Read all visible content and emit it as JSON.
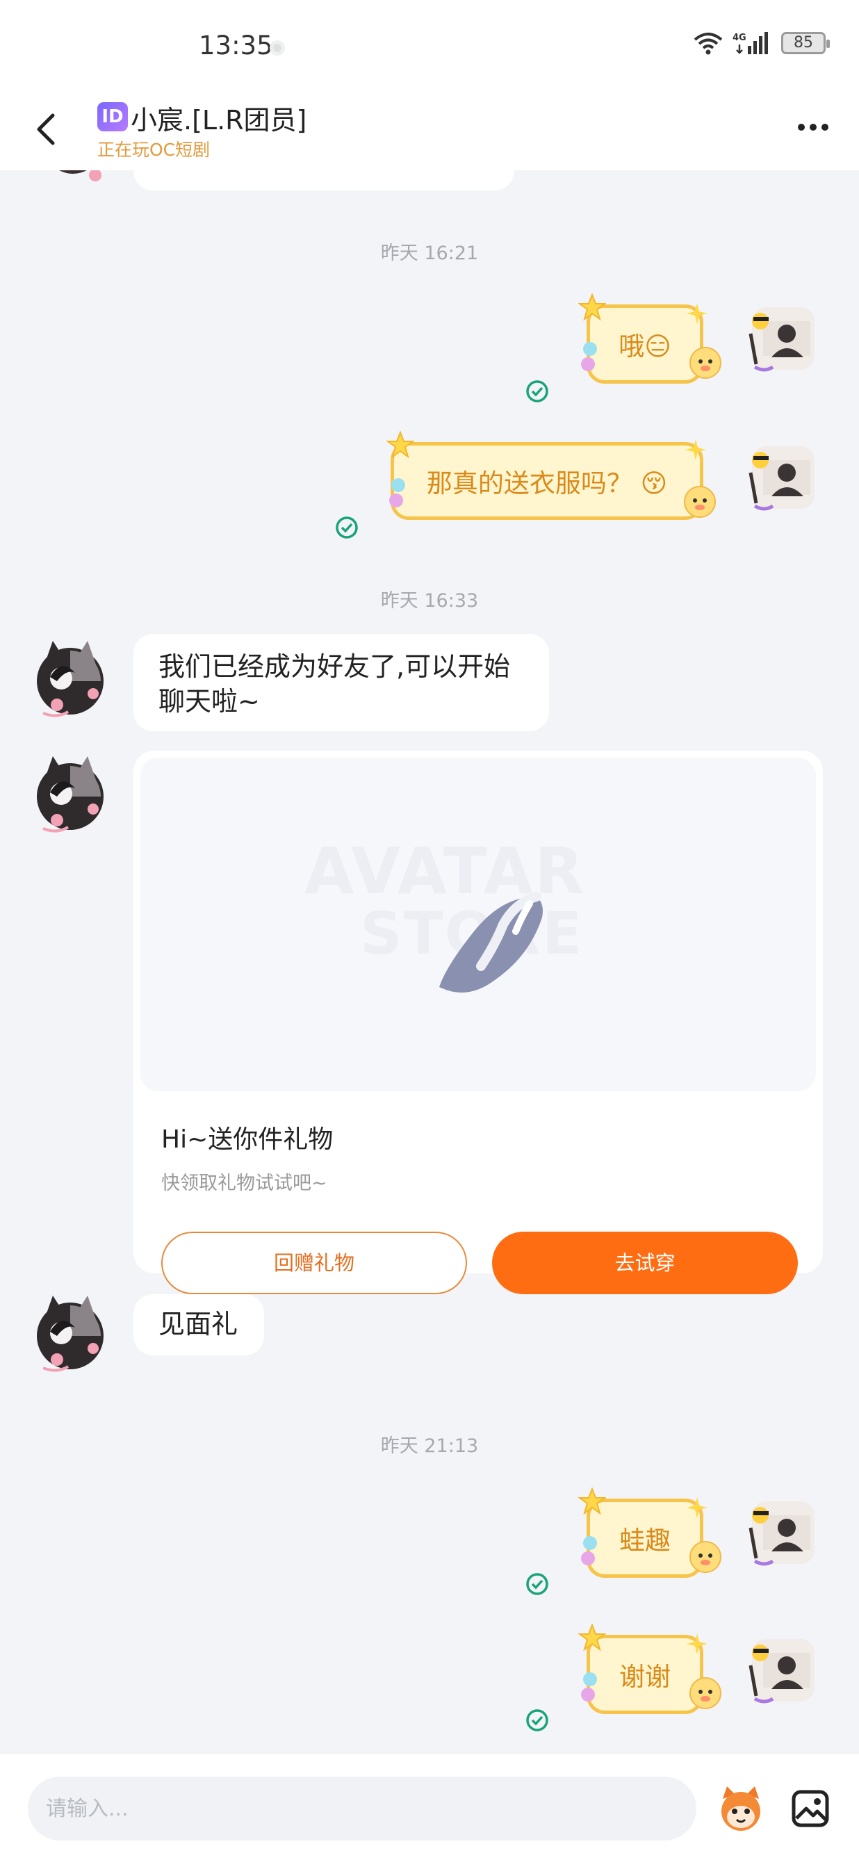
{
  "status_bar": {
    "time": "13:35",
    "network": "4G",
    "battery": "85"
  },
  "header": {
    "id_badge": "ID",
    "title": "小宸.[L.R团员]",
    "subtitle": "正在玩OC短剧"
  },
  "messages": {
    "ts1": "昨天 16:21",
    "out1": "哦😑",
    "out2": "那真的送衣服吗？ 😚",
    "ts2": "昨天 16:33",
    "in1": "我们已经成为好友了,可以开始聊天啦~",
    "ts3": "昨天 21:13",
    "in3": "见面礼",
    "out3": "蛙趣",
    "out4": "谢谢"
  },
  "gift_card": {
    "watermark_line1": "AVATAR",
    "watermark_line2": "STORE",
    "title": "Hi~送你件礼物",
    "subtitle": "快领取礼物试试吧~",
    "return_button": "回赠礼物",
    "try_button": "去试穿"
  },
  "input": {
    "placeholder": "请输入..."
  },
  "colors": {
    "accent_orange": "#ff6d13",
    "bubble_border": "#f6c44a",
    "bubble_fill": "#fff6cf",
    "read_green": "#19a37a"
  }
}
